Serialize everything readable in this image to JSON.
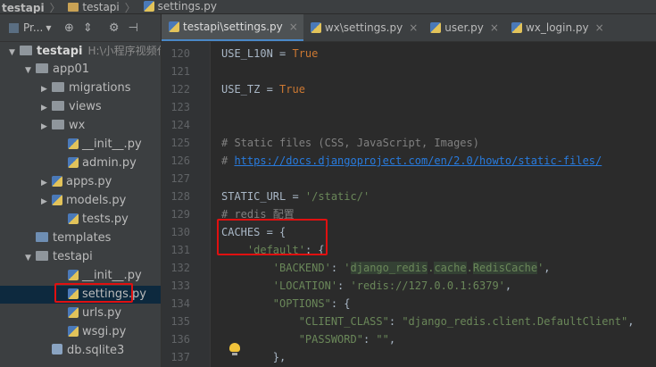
{
  "breadcrumb": [
    "testapi",
    "testapi",
    "settings.py"
  ],
  "project_toolbar": {
    "label": "Pr..."
  },
  "tree": [
    {
      "label": "testapi",
      "path": "H:\\小程序视频代",
      "kind": "root",
      "arrow": "▼",
      "depth": 0
    },
    {
      "label": "app01",
      "kind": "folder",
      "arrow": "▼",
      "depth": 1
    },
    {
      "label": "migrations",
      "kind": "folder",
      "arrow": "▶",
      "depth": 2
    },
    {
      "label": "views",
      "kind": "folder",
      "arrow": "▶",
      "depth": 2
    },
    {
      "label": "wx",
      "kind": "folder",
      "arrow": "▶",
      "depth": 2
    },
    {
      "label": "__init__.py",
      "kind": "py",
      "arrow": "",
      "depth": 3
    },
    {
      "label": "admin.py",
      "kind": "py",
      "arrow": "",
      "depth": 3
    },
    {
      "label": "apps.py",
      "kind": "py",
      "arrow": "▶",
      "depth": 2
    },
    {
      "label": "models.py",
      "kind": "py",
      "arrow": "▶",
      "depth": 2
    },
    {
      "label": "tests.py",
      "kind": "py",
      "arrow": "",
      "depth": 3
    },
    {
      "label": "templates",
      "kind": "folder",
      "arrow": "",
      "depth": 1
    },
    {
      "label": "testapi",
      "kind": "folder",
      "arrow": "▼",
      "depth": 1
    },
    {
      "label": "__init__.py",
      "kind": "py",
      "arrow": "",
      "depth": 3
    },
    {
      "label": "settings.py",
      "kind": "py",
      "arrow": "",
      "depth": 3,
      "selected": true
    },
    {
      "label": "urls.py",
      "kind": "py",
      "arrow": "",
      "depth": 3
    },
    {
      "label": "wsgi.py",
      "kind": "py",
      "arrow": "",
      "depth": 3
    },
    {
      "label": "db.sqlite3",
      "kind": "db",
      "arrow": "",
      "depth": 2
    }
  ],
  "tabs": [
    {
      "label": "testapi\\settings.py",
      "active": true
    },
    {
      "label": "wx\\settings.py",
      "active": false
    },
    {
      "label": "user.py",
      "active": false
    },
    {
      "label": "wx_login.py",
      "active": false
    }
  ],
  "line_numbers": [
    "120",
    "121",
    "122",
    "123",
    "124",
    "125",
    "126",
    "127",
    "128",
    "129",
    "130",
    "131",
    "132",
    "133",
    "134",
    "135",
    "136",
    "137"
  ],
  "code": [
    [
      {
        "t": "USE_L10N = "
      },
      {
        "t": "True",
        "c": "kw"
      }
    ],
    [],
    [
      {
        "t": "USE_TZ = "
      },
      {
        "t": "True",
        "c": "kw"
      }
    ],
    [],
    [],
    [
      {
        "t": "# Static files (CSS, JavaScript, Images)",
        "c": "cm"
      }
    ],
    [
      {
        "t": "# ",
        "c": "cm"
      },
      {
        "t": "https://docs.djangoproject.com/en/2.0/howto/static-files/",
        "c": "link"
      }
    ],
    [],
    [
      {
        "t": "STATIC_URL = "
      },
      {
        "t": "'/static/'",
        "c": "str"
      }
    ],
    [
      {
        "t": "# redis 配置",
        "c": "cm"
      }
    ],
    [
      {
        "t": "CACHES = {"
      }
    ],
    [
      {
        "t": "    "
      },
      {
        "t": "'default'",
        "c": "str"
      },
      {
        "t": ": {"
      }
    ],
    [
      {
        "t": "        "
      },
      {
        "t": "'BACKEND'",
        "c": "str"
      },
      {
        "t": ": "
      },
      {
        "t": "'",
        "c": "str"
      },
      {
        "t": "django_redis",
        "c": "str hl"
      },
      {
        "t": ".",
        "c": "str"
      },
      {
        "t": "cache",
        "c": "str hl"
      },
      {
        "t": ".",
        "c": "str"
      },
      {
        "t": "RedisCache",
        "c": "str hl"
      },
      {
        "t": "'",
        "c": "str"
      },
      {
        "t": ","
      }
    ],
    [
      {
        "t": "        "
      },
      {
        "t": "'LOCATION'",
        "c": "str"
      },
      {
        "t": ": "
      },
      {
        "t": "'redis://127.0.0.1:6379'",
        "c": "str"
      },
      {
        "t": ","
      }
    ],
    [
      {
        "t": "        "
      },
      {
        "t": "\"OPTIONS\"",
        "c": "str"
      },
      {
        "t": ": {"
      }
    ],
    [
      {
        "t": "            "
      },
      {
        "t": "\"CLIENT_CLASS\"",
        "c": "str"
      },
      {
        "t": ": "
      },
      {
        "t": "\"django_redis.client.DefaultClient\"",
        "c": "str"
      },
      {
        "t": ","
      }
    ],
    [
      {
        "t": "            "
      },
      {
        "t": "\"PASSWORD\"",
        "c": "str"
      },
      {
        "t": ": "
      },
      {
        "t": "\"\"",
        "c": "str"
      },
      {
        "t": ","
      }
    ],
    [
      {
        "t": "        "
      },
      {
        "t": "},"
      }
    ]
  ]
}
